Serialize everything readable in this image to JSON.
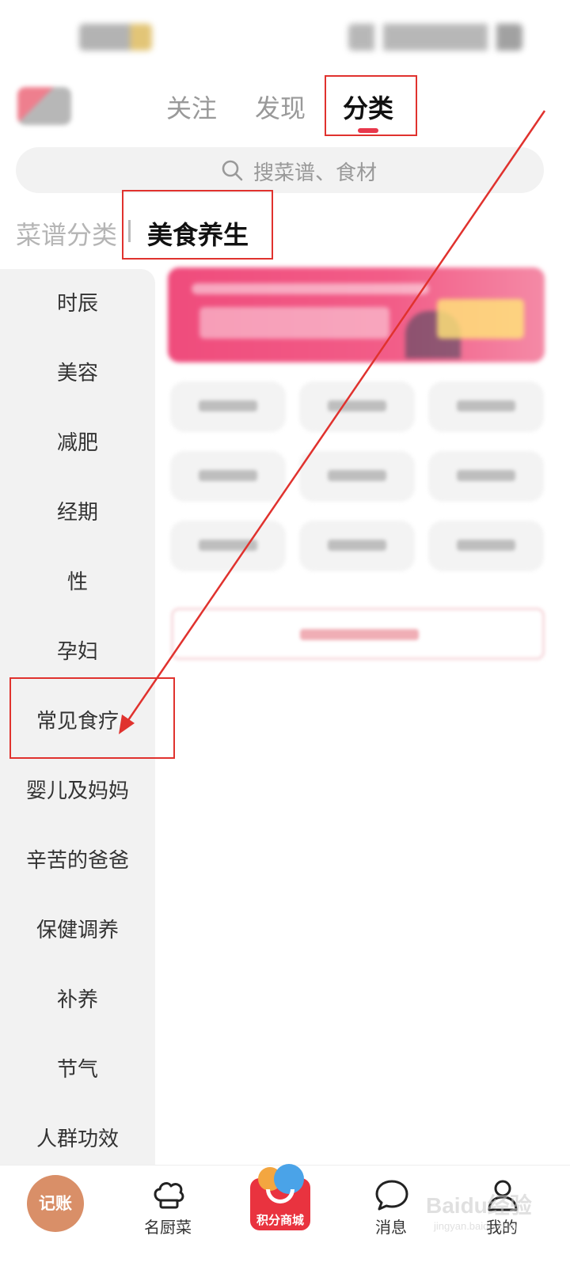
{
  "header": {
    "tabs": [
      {
        "label": "关注"
      },
      {
        "label": "发现"
      },
      {
        "label": "分类",
        "active": true
      }
    ]
  },
  "search": {
    "placeholder": "搜菜谱、食材"
  },
  "sub_tabs": [
    {
      "label": "菜谱分类"
    },
    {
      "label": "美食养生",
      "active": true
    }
  ],
  "sidebar": {
    "items": [
      {
        "label": "时辰"
      },
      {
        "label": "美容"
      },
      {
        "label": "减肥"
      },
      {
        "label": "经期"
      },
      {
        "label": "性"
      },
      {
        "label": "孕妇"
      },
      {
        "label": "常见食疗",
        "highlighted": true
      },
      {
        "label": "婴儿及妈妈"
      },
      {
        "label": "辛苦的爸爸"
      },
      {
        "label": "保健调养"
      },
      {
        "label": "补养"
      },
      {
        "label": "节气"
      },
      {
        "label": "人群功效"
      }
    ]
  },
  "bottom_nav": {
    "ledger": "记账",
    "chef": "名厨菜",
    "mall": "积分商城",
    "messages": "消息",
    "mine": "我的"
  },
  "watermark": {
    "title": "Baidu经验",
    "sub": "jingyan.baidu.com"
  },
  "colors": {
    "accent": "#e8374b",
    "annotation": "#e0322e",
    "ledger": "#d98f68",
    "mall": "#e9333f"
  }
}
